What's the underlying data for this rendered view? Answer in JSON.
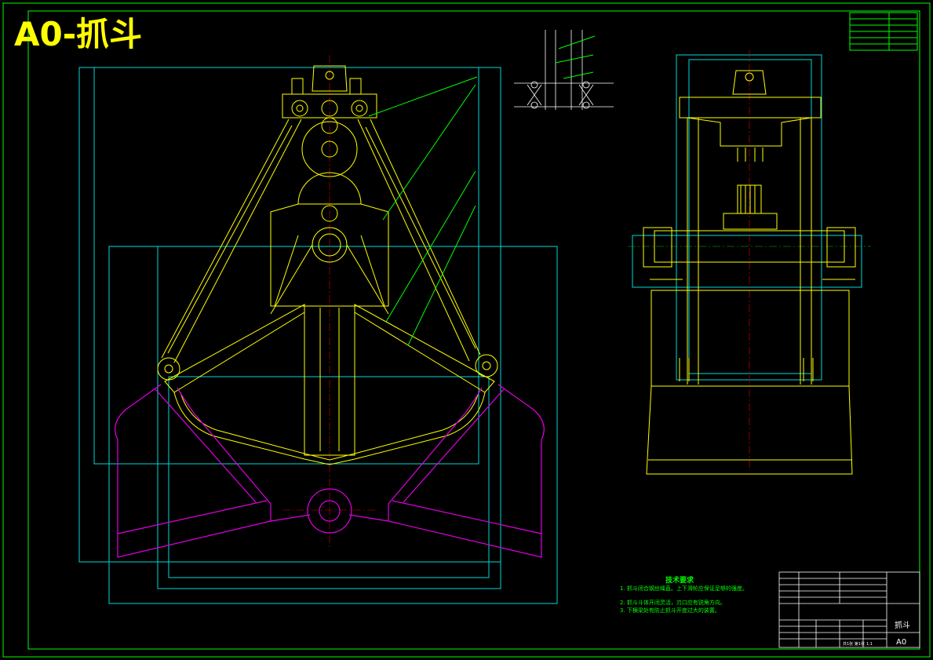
{
  "sheet": {
    "title": "A0-抓斗",
    "border_color": "#00ff00",
    "colors": {
      "outline": "#ffff00",
      "frame": "#00d8d8",
      "leader": "#00ff00",
      "open_position": "#e000e0",
      "centerline": "#e00000",
      "background": "#000000"
    }
  },
  "tech_requirements": {
    "heading": "技术要求",
    "items": [
      "1. 抓斗闭合钢丝绳直。上下滑轮应保证足够的强度。",
      "2. 抓斗斗体开闭灵活，刃口应有锐角方向。",
      "3. 下横梁处有防止抓斗开度过大的装置。"
    ]
  },
  "title_block": {
    "drawing_name": "抓斗",
    "sheet_size": "A0",
    "scale": "1:1",
    "sheet_no": "共1张 第1张"
  }
}
